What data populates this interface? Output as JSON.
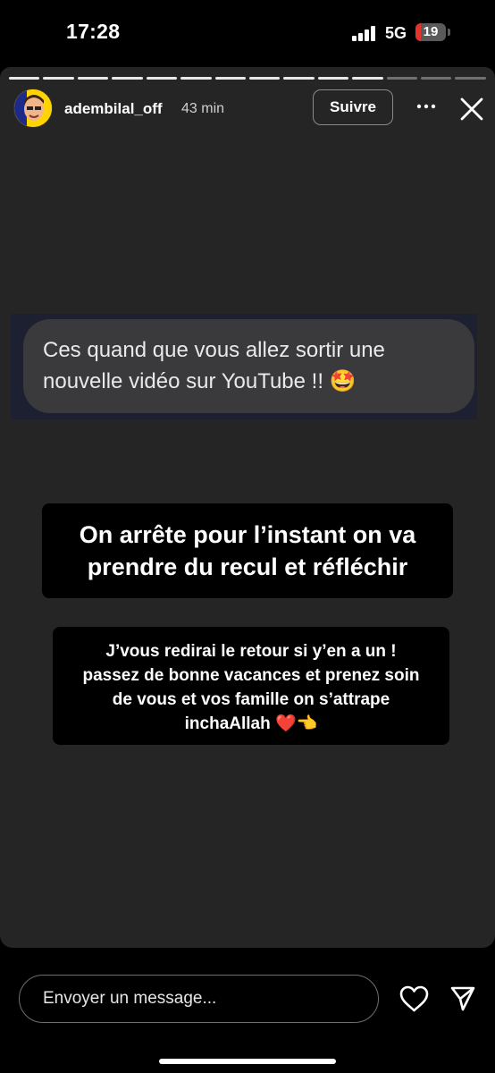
{
  "status_bar": {
    "time": "17:28",
    "network": "5G",
    "battery": "19",
    "battery_level": 0.19
  },
  "story": {
    "segments_total": 14,
    "segments_done": 11,
    "username": "adembilal_off",
    "time_ago": "43 min",
    "follow_label": "Suivre",
    "question": "Ces quand que vous allez sortir une nouvelle vidéo sur YouTube !! 🤩",
    "caption_1": [
      "On arrête pour l’instant on va",
      "prendre du recul et réfléchir"
    ],
    "caption_2": [
      "J’vous redirai le retour si y’en a un !",
      "passez de bonne vacances et prenez soin",
      "de vous et vos famille on s’attrape",
      "inchaAllah ❤️👈"
    ]
  },
  "reply": {
    "placeholder": "Envoyer un message..."
  },
  "colors": {
    "story_bg": "#252525",
    "bubble": "#3a3a3c",
    "battery_low": "#e0342c"
  },
  "icons": [
    "signal-icon",
    "battery-icon",
    "more-icon",
    "close-icon",
    "heart-icon",
    "send-icon"
  ]
}
